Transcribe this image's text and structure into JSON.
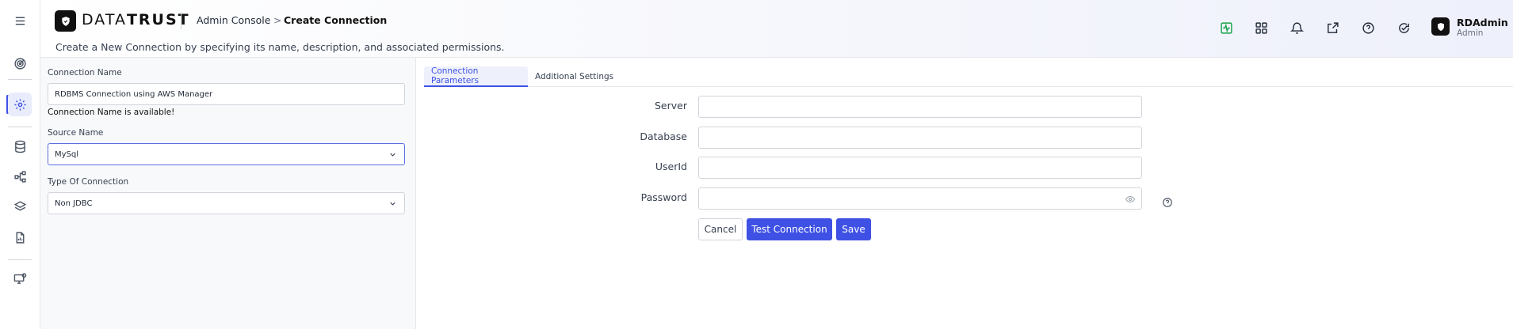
{
  "brand": {
    "name_light": "DATA",
    "name_bold": "TRUST"
  },
  "breadcrumb": {
    "root": "Admin Console",
    "separator": ">",
    "current": "Create Connection"
  },
  "page": {
    "subtitle": "Create a New Connection by specifying its name, description, and associated permissions."
  },
  "user": {
    "name": "RDAdmin",
    "role": "Admin"
  },
  "sidebar": {
    "items": [
      {
        "icon": "menu-icon"
      },
      {
        "icon": "target-icon"
      },
      {
        "icon": "settings-icon",
        "active": true
      },
      {
        "icon": "database-icon"
      },
      {
        "icon": "connections-icon"
      },
      {
        "icon": "layers-icon"
      },
      {
        "icon": "report-icon"
      },
      {
        "icon": "monitor-icon"
      }
    ]
  },
  "header_icons": [
    "activity-icon",
    "grid-icon",
    "bell-icon",
    "external-link-icon",
    "help-icon",
    "refresh-icon"
  ],
  "form": {
    "connection_name_label": "Connection Name",
    "connection_name_value": "RDBMS Connection using AWS Manager",
    "availability_message": "Connection Name is available!",
    "source_name_label": "Source Name",
    "source_name_value": "MySql",
    "type_label": "Type Of Connection",
    "type_value": "Non JDBC"
  },
  "tabs": [
    {
      "label": "Connection Parameters",
      "active": true
    },
    {
      "label": "Additional Settings",
      "active": false
    }
  ],
  "params": {
    "server_label": "Server",
    "server_value": "",
    "database_label": "Database",
    "database_value": "",
    "userid_label": "UserId",
    "userid_value": "",
    "password_label": "Password",
    "password_value": ""
  },
  "actions": {
    "cancel": "Cancel",
    "test": "Test Connection",
    "save": "Save"
  },
  "colors": {
    "accent": "#3f51e5",
    "activity": "#16a34a"
  }
}
